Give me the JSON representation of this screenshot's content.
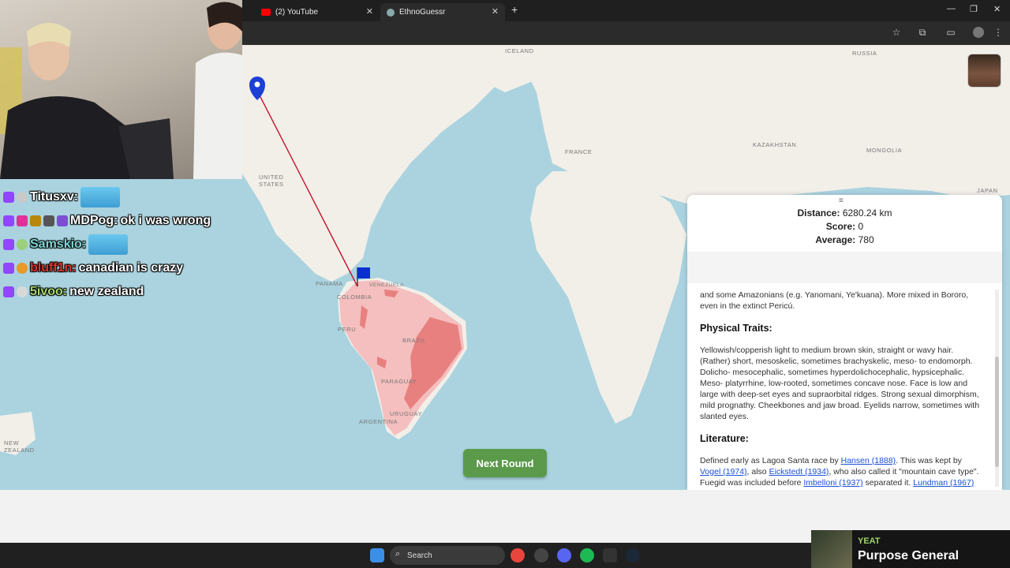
{
  "browser": {
    "tabs": [
      {
        "label": "(2) YouTube",
        "icon": "youtube-icon",
        "active": false
      },
      {
        "label": "EthnoGuessr",
        "icon": "globe-icon",
        "active": true
      }
    ],
    "new_tab_symbol": "+"
  },
  "map": {
    "labels": [
      "ICELAND",
      "RUSSIA",
      "UNITED STATES",
      "FRANCE",
      "KAZAKHSTAN",
      "MONGOLIA",
      "JAPAN",
      "PANAMA",
      "VENEZUELA",
      "COLOMBIA",
      "PERU",
      "BRAZIL",
      "PARAGUAY",
      "URUGUAY",
      "ARGENTINA",
      "NEW ZEALAND"
    ],
    "colors": {
      "sea": "#aad3df",
      "land": "#f2efe9",
      "region_light": "#f4b6b6",
      "region_dark": "#e88080",
      "guess_line": "#c8102e",
      "guess_marker": "#1c3fd6"
    }
  },
  "results": {
    "handle": "≡",
    "distance_label": "Distance:",
    "distance_value": "6280.24 km",
    "score_label": "Score:",
    "score_value": "0",
    "average_label": "Average:",
    "average_value": "780",
    "intro_text": "and some Amazonians (e.g. Yanomani, Ye'kuana). More mixed in Bororo, even in the extinct Pericú.",
    "physical_heading": "Physical Traits:",
    "physical_text": "Yellowish/copperish light to medium brown skin, straight or wavy hair. (Rather) short, mesoskelic, sometimes brachyskelic, meso- to endomorph. Dolicho- mesocephalic, sometimes hyperdolichocephalic, hypsicephalic. Meso- platyrrhine, low-rooted, sometimes concave nose. Face is low and large with deep-set eyes and supraorbital ridges. Strong sexual dimorphism, mild prognathy. Cheekbones and jaw broad. Eyelids narrow, sometimes with slanted eyes.",
    "literature_heading": "Literature:",
    "lit": {
      "t1": "Defined early as Lagoa Santa race by ",
      "l1": "Hansen (1888)",
      "t2": ". This was kept by ",
      "l2": "Vogel (1974)",
      "t3": ", also ",
      "l3": "Eickstedt (1934)",
      "t4": ", who also called it \"mountain cave type\". Fuegid was included before ",
      "l4": "Imbelloni (1937)",
      "t5": " separated it. ",
      "l5": "Lundman (1967)"
    }
  },
  "next_round_label": "Next Round",
  "chat": [
    {
      "user": "Titusxv:",
      "user_color": "#ffffff",
      "message": "",
      "emote": true
    },
    {
      "user": "MDPog:",
      "user_color": "#ffffff",
      "message": "ok i was wrong",
      "emote": false
    },
    {
      "user": "Samskio:",
      "user_color": "#7fd6d6",
      "message": "",
      "emote": true
    },
    {
      "user": "bluff1n:",
      "user_color": "#e0362b",
      "message": "canadian is crazy",
      "emote": false
    },
    {
      "user": "5ivoo:",
      "user_color": "#a6d86a",
      "message": "new zealand",
      "emote": false
    }
  ],
  "taskbar": {
    "search_placeholder": "Search"
  },
  "now_playing": {
    "artist": "YEAT",
    "title": "Purpose General"
  }
}
